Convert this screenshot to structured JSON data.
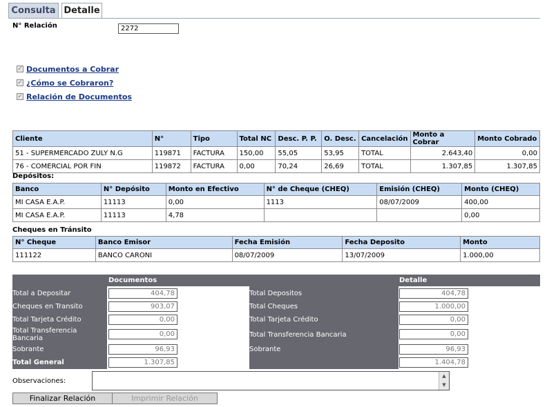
{
  "tabs": [
    {
      "label": "Consulta"
    },
    {
      "label": "Detalle"
    }
  ],
  "relacion": {
    "label": "N° Relación",
    "value": "2272"
  },
  "links": [
    {
      "label": "Documentos a Cobrar"
    },
    {
      "label": "¿Cómo se Cobraron?"
    },
    {
      "label": "Relación de Documentos"
    }
  ],
  "documentos": {
    "headers": [
      "Cliente",
      "N°",
      "Tipo",
      "Total NC",
      "Desc. P. P.",
      "O. Desc.",
      "Cancelación",
      "Monto a Cobrar",
      "Monto Cobrado"
    ],
    "rows": [
      [
        "51 - SUPERMERCADO ZULY N.G",
        "119871",
        "FACTURA",
        "150,00",
        "55,05",
        "53,95",
        "TOTAL",
        "2.643,40",
        "0,00"
      ],
      [
        "76 - COMERCIAL POR FIN",
        "119872",
        "FACTURA",
        "0,00",
        "70,24",
        "26,69",
        "TOTAL",
        "1.307,85",
        "1.307,85"
      ]
    ]
  },
  "depositos": {
    "title": "Depósitos:",
    "headers": [
      "Banco",
      "N° Depósito",
      "Monto en Efectivo",
      "N° de Cheque (CHEQ)",
      "Emisión (CHEQ)",
      "Monto (CHEQ)"
    ],
    "rows": [
      [
        "MI CASA E.A.P.",
        "11113",
        "0,00",
        "1113",
        "08/07/2009",
        "400,00"
      ],
      [
        "MI CASA E.A.P.",
        "11113",
        "4,78",
        "",
        "",
        "0,00"
      ]
    ]
  },
  "cheques": {
    "title": "Cheques en Tránsito",
    "headers": [
      "N° Cheque",
      "Banco Emisor",
      "Fecha Emisión",
      "Fecha Deposito",
      "Monto"
    ],
    "rows": [
      [
        "111122",
        "BANCO CARONI",
        "08/07/2009",
        "13/07/2009",
        "1.000,00"
      ]
    ]
  },
  "resumen": {
    "documentos_title": "Documentos",
    "detalle_title": "Detalle",
    "left": [
      {
        "label": "Total a Depositar",
        "value": "404,78"
      },
      {
        "label": "Cheques en Transito",
        "value": "903,07"
      },
      {
        "label": "Total Tarjeta Crédito",
        "value": "0,00"
      },
      {
        "label": "Total Transferencia Bancaria",
        "value": "0,00"
      },
      {
        "label": "Sobrante",
        "value": "96,93"
      },
      {
        "label": "Total General",
        "value": "1.307,85"
      }
    ],
    "right": [
      {
        "label": "Total Depositos",
        "value": "404,78"
      },
      {
        "label": "Total Cheques",
        "value": "1.000,00"
      },
      {
        "label": "Total Tarjeta Crédito",
        "value": "0,00"
      },
      {
        "label": "Total Transferencia Bancaria",
        "value": "0,00"
      },
      {
        "label": "Sobrante",
        "value": "96,93"
      },
      {
        "label": "",
        "value": "1.404,78"
      }
    ]
  },
  "observaciones": {
    "label": "Observaciones:",
    "value": ""
  },
  "buttons": {
    "finalizar": "Finalizar Relación",
    "imprimir": "Imprimir Relación"
  }
}
